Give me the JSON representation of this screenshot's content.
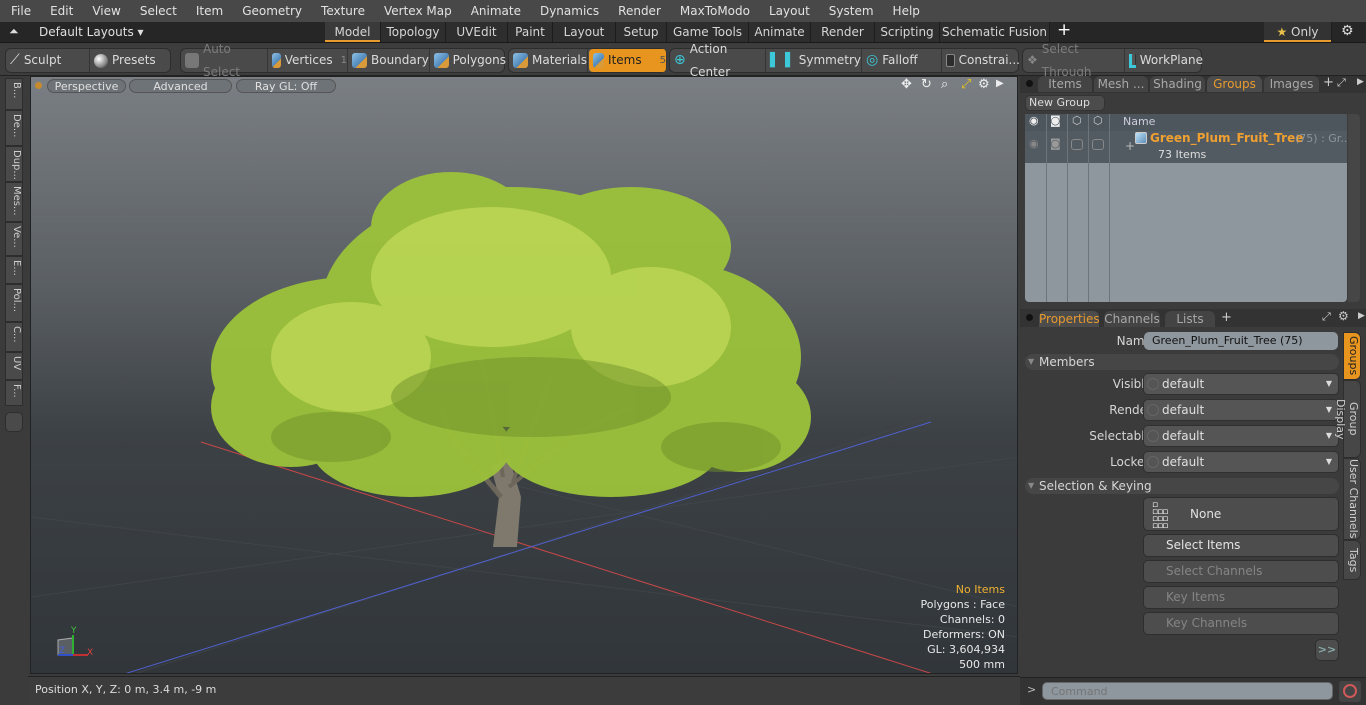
{
  "menubar": {
    "items": [
      "File",
      "Edit",
      "View",
      "Select",
      "Item",
      "Geometry",
      "Texture",
      "Vertex Map",
      "Animate",
      "Dynamics",
      "Render",
      "MaxToModo",
      "Layout",
      "System",
      "Help"
    ]
  },
  "layoutbar": {
    "layouts_dropdown": "Default Layouts ▾",
    "tabs": [
      "Model",
      "Topology",
      "UVEdit",
      "Paint",
      "Layout",
      "Setup",
      "Game Tools",
      "Animate",
      "Render",
      "Scripting",
      "Schematic Fusion"
    ],
    "active_tab": "Model",
    "add_tab": "+",
    "only_label": "Only",
    "star": "★"
  },
  "toolbar": {
    "sculpt": "Sculpt",
    "presets": "Presets",
    "auto_select": "Auto Select",
    "vertices": "Vertices",
    "vertices_count": "1",
    "boundary": "Boundary",
    "polygons": "Polygons",
    "materials": "Materials",
    "items": "Items",
    "items_count": "5",
    "action_center": "Action Center",
    "symmetry": "Symmetry",
    "falloff": "Falloff",
    "constraints": "Constrai...",
    "select_through": "Select Through",
    "workplane": "WorkPlane"
  },
  "left_tabs": [
    "B...",
    "De...",
    "Dup...",
    "Mes...",
    "Ve...",
    "E...",
    "Pol...",
    "C...",
    "UV",
    "F..."
  ],
  "viewport": {
    "buttons": [
      "Perspective",
      "Advanced",
      "Ray GL: Off"
    ],
    "info": {
      "selection": "No Items",
      "polygons": "Polygons : Face",
      "channels": "Channels: 0",
      "deformers": "Deformers: ON",
      "gl": "GL: 3,604,934",
      "scale": "500 mm"
    },
    "axis_labels": {
      "x": "X",
      "y": "Y",
      "z": "Z"
    }
  },
  "statusbar": {
    "position": "Position X, Y, Z:   0 m, 3.4 m, -9 m"
  },
  "groups_panel": {
    "tabs": [
      "Items",
      "Mesh ...",
      "Shading",
      "Groups",
      "Images"
    ],
    "active_tab": "Groups",
    "new_group": "New Group",
    "col_name": "Name",
    "group": {
      "name": "Green_Plum_Fruit_Tree",
      "suffix": "(75) : Gr...",
      "count": "73 Items"
    }
  },
  "properties_panel": {
    "tabs": [
      "Properties",
      "Channels",
      "Lists"
    ],
    "active_tab": "Properties",
    "name_label": "Name",
    "name_value": "Green_Plum_Fruit_Tree (75)",
    "members_section": "Members",
    "fields": [
      {
        "label": "Visible",
        "value": "default"
      },
      {
        "label": "Render",
        "value": "default"
      },
      {
        "label": "Selectable",
        "value": "default"
      },
      {
        "label": "Locked",
        "value": "default"
      }
    ],
    "selection_section": "Selection & Keying",
    "none_button": "None",
    "select_items": "Select Items",
    "select_channels": "Select Channels",
    "key_items": "Key Items",
    "key_channels": "Key Channels",
    "more": ">>",
    "side_tabs": [
      "Groups",
      "Group Display",
      "User Channels",
      "Tags"
    ]
  },
  "command": {
    "prompt": ">",
    "placeholder": "Command"
  },
  "colors": {
    "accent": "#e8951f",
    "group_name": "#f0a030"
  }
}
